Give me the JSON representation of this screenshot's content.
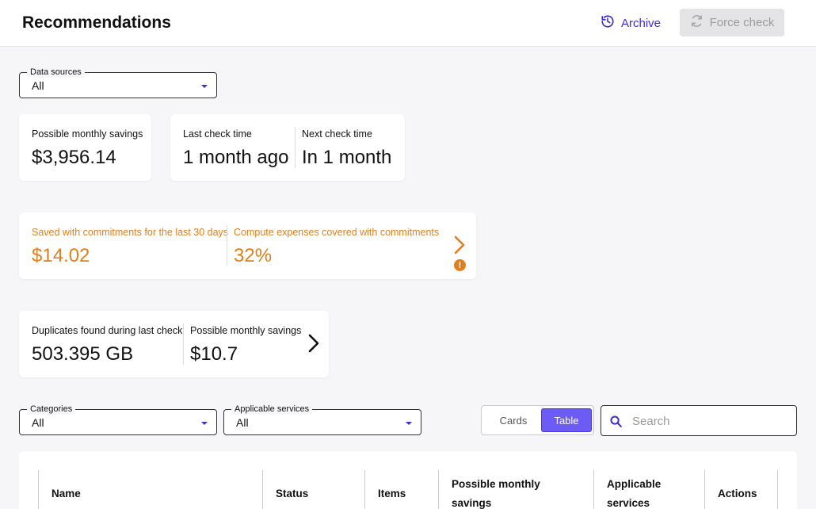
{
  "header": {
    "title": "Recommendations",
    "archive_label": "Archive",
    "force_check_label": "Force check"
  },
  "filters": {
    "data_sources": {
      "label": "Data sources",
      "value": "All"
    },
    "categories": {
      "label": "Categories",
      "value": "All"
    },
    "applicable_services": {
      "label": "Applicable services",
      "value": "All"
    }
  },
  "summary": {
    "possible_savings": {
      "label": "Possible monthly savings",
      "value": "$3,956.14"
    },
    "last_check": {
      "label": "Last check time",
      "value": "1 month ago"
    },
    "next_check": {
      "label": "Next check time",
      "value": "In 1 month"
    }
  },
  "commitments": {
    "saved": {
      "label": "Saved with commitments for the last 30 days",
      "value": "$14.02"
    },
    "covered": {
      "label": "Compute expenses covered with commitments",
      "value": "32%"
    },
    "warning_symbol": "!",
    "accent_color": "#e07f1d"
  },
  "duplicates": {
    "found": {
      "label": "Duplicates found during last check",
      "value": "503.395 GB"
    },
    "savings": {
      "label": "Possible monthly savings",
      "value": "$10.7"
    }
  },
  "view_toggle": {
    "cards_label": "Cards",
    "table_label": "Table",
    "selected": "Table"
  },
  "search": {
    "placeholder": "Search",
    "value": ""
  },
  "table": {
    "headers": {
      "name": "Name",
      "status": "Status",
      "items": "Items",
      "savings_line1": "Possible monthly",
      "savings_line2": "savings",
      "services_line1": "Applicable",
      "services_line2": "services",
      "actions": "Actions"
    }
  },
  "colors": {
    "brand": "#3d2fcf",
    "toggle_active": "#6c5cf5",
    "warning": "#e07f1d"
  },
  "icons": {
    "archive": "history-clock-icon",
    "force_check": "refresh-icon",
    "search": "search-icon",
    "chevron": "chevron-right-icon",
    "dropdown": "caret-down-icon"
  }
}
